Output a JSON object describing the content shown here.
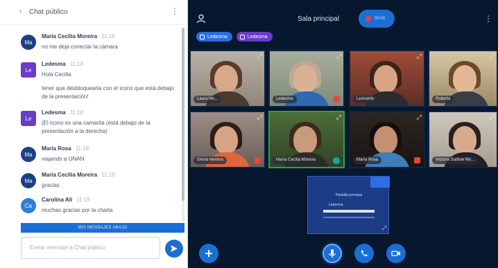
{
  "chat": {
    "title": "Chat público",
    "composer_placeholder": "Enviar mensaje a Chat público",
    "welcome_label": "MIS MENSAJES ABAJO",
    "messages": [
      {
        "initials": "Ma",
        "name": "María Cecilia Moreira",
        "time": "11:18",
        "text": "no me deja conectar la cámara"
      },
      {
        "initials": "Le",
        "name": "Ledesma",
        "time": "11:18",
        "text": "Hola Cecilia",
        "text2": "tener que desbloquearla con el ícono que está debajo de la presentación!"
      },
      {
        "initials": "Le",
        "name": "Ledesma",
        "time": "11:18",
        "text": "(El ícono es una camarita (está debajo de la presentación a la derecha)"
      },
      {
        "initials": "Ma",
        "name": "María Rosa",
        "time": "11:18",
        "text": "viajando a UNAN"
      },
      {
        "initials": "Ma",
        "name": "María Cecilia Moreira",
        "time": "11:19",
        "text": "gracias"
      },
      {
        "initials": "Ca",
        "name": "Carolina Alí",
        "time": "11:19",
        "text": "muchas gracias por la charla"
      }
    ]
  },
  "header": {
    "room_title": "Sala principal",
    "record_label": "00:00"
  },
  "presenters": [
    "Ledesma",
    "Ledesma"
  ],
  "participants": [
    {
      "name": "Laura Mo..."
    },
    {
      "name": "Ledesma"
    },
    {
      "name": "Leonardo"
    },
    {
      "name": "Roberta"
    },
    {
      "name": "Gloria Herrera"
    },
    {
      "name": "María Cecilia Moreira"
    },
    {
      "name": "María Rosa"
    },
    {
      "name": "Victoria Sudlow Mo..."
    }
  ],
  "screenshare": {
    "title": "Pantalla principal",
    "name": "Ledesma"
  },
  "colors": {
    "accent": "#1b6fd3",
    "video_bg": "#06172e",
    "mute": "#e2473f",
    "ledesma_avatar": "#6a3cc9",
    "user_avatar": "#1c3f85"
  },
  "icons": {
    "back": "chevron-left-icon",
    "menu": "kebab-menu-icon",
    "send": "send-icon",
    "user": "user-icon",
    "add": "plus-icon",
    "mic": "microphone-icon",
    "phone": "phone-icon",
    "camera": "camera-icon"
  }
}
